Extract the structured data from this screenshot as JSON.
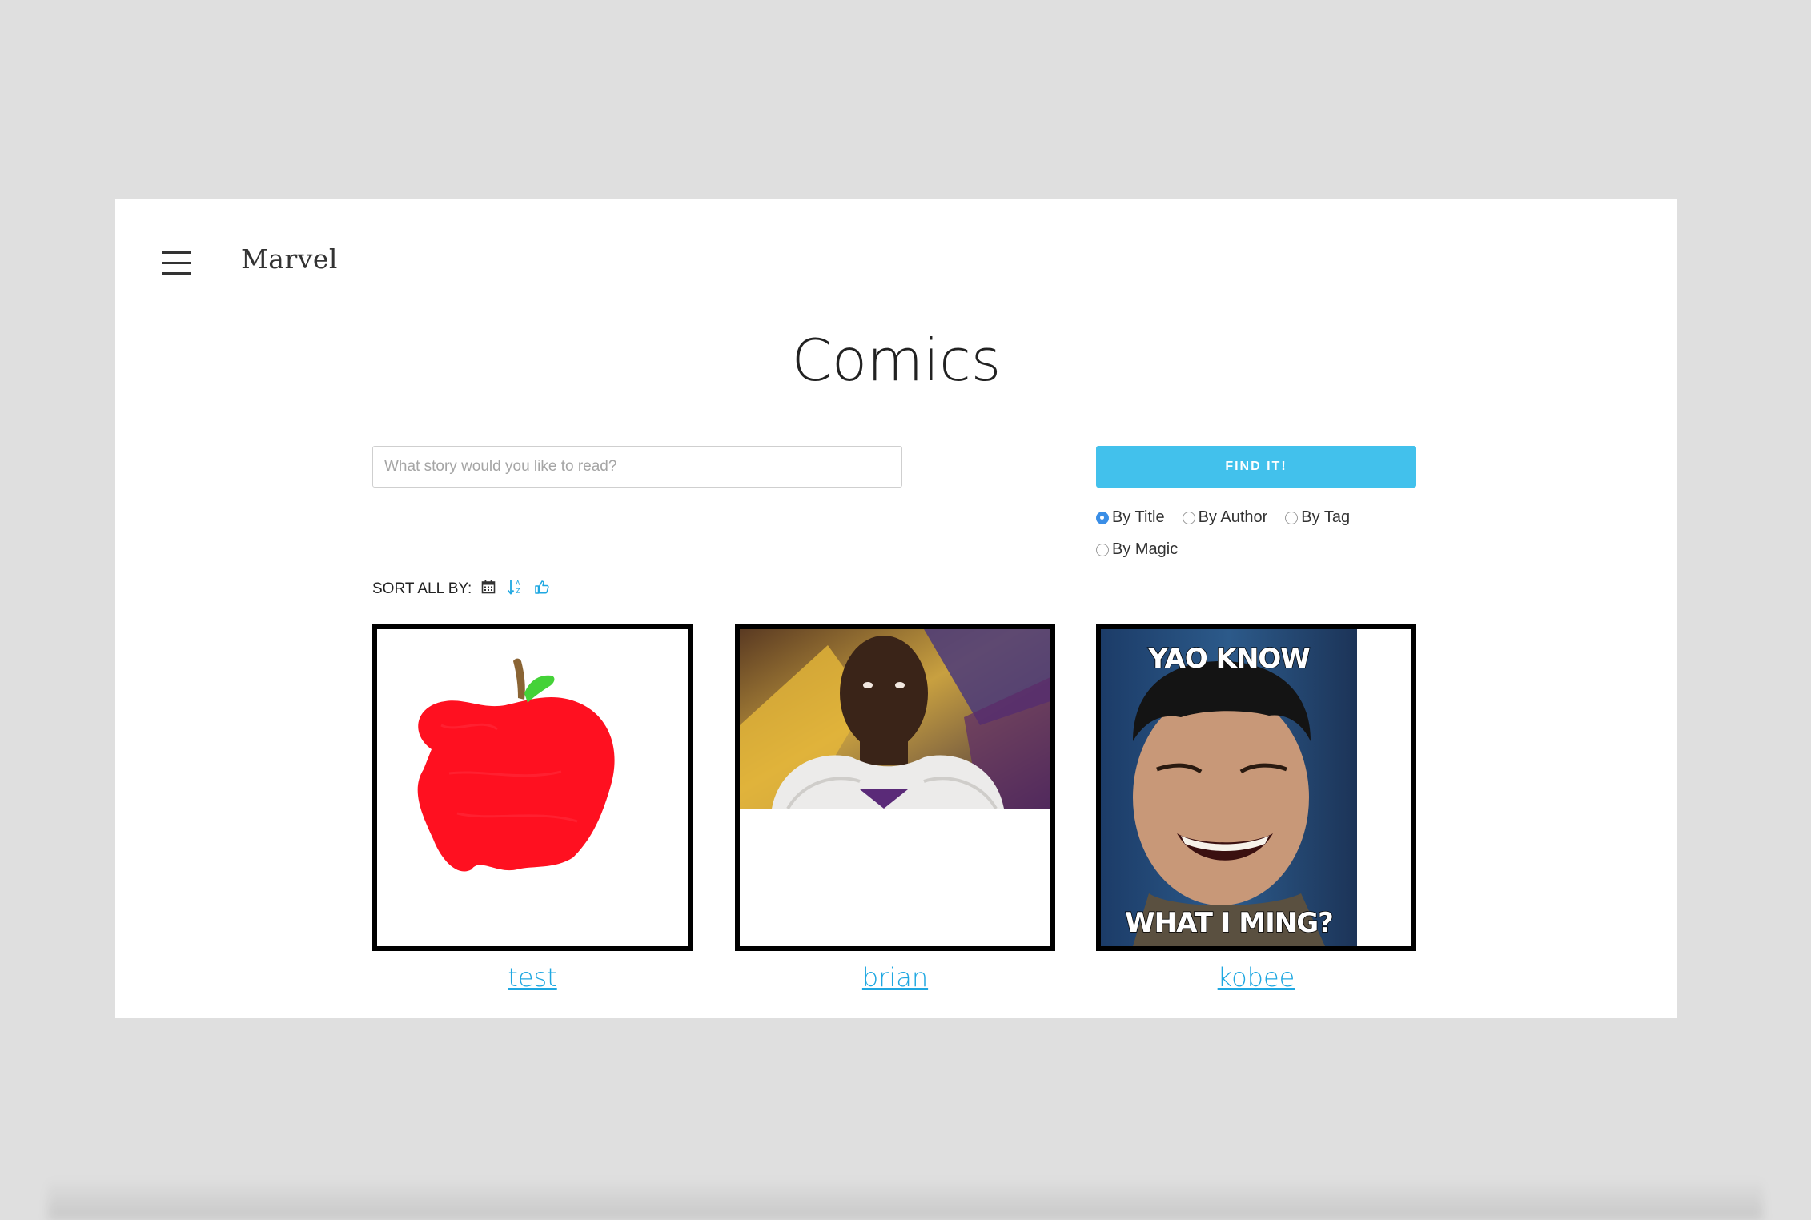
{
  "header": {
    "brand": "Marvel"
  },
  "page": {
    "title": "Comics"
  },
  "search": {
    "placeholder": "What story would you like to read?",
    "value": "",
    "button_label": "FIND IT!",
    "options": [
      {
        "label": "By Title",
        "checked": true
      },
      {
        "label": "By Author",
        "checked": false
      },
      {
        "label": "By Tag",
        "checked": false
      },
      {
        "label": "By Magic",
        "checked": false
      }
    ]
  },
  "sort": {
    "label": "SORT ALL BY:",
    "icons": [
      "calendar-icon",
      "sort-alpha-icon",
      "thumbs-up-icon"
    ]
  },
  "comics": [
    {
      "title": "test",
      "thumbnail": "red-apple-drawing"
    },
    {
      "title": "brian",
      "thumbnail": "basketball-player-photo"
    },
    {
      "title": "kobee",
      "thumbnail": "meme-photo",
      "meme_top": "YAO KNOW",
      "meme_bottom": "WHAT I MING?"
    }
  ],
  "colors": {
    "accent": "#42c1ec",
    "link": "#1ea7e1",
    "radio_checked": "#3a8ee6"
  }
}
